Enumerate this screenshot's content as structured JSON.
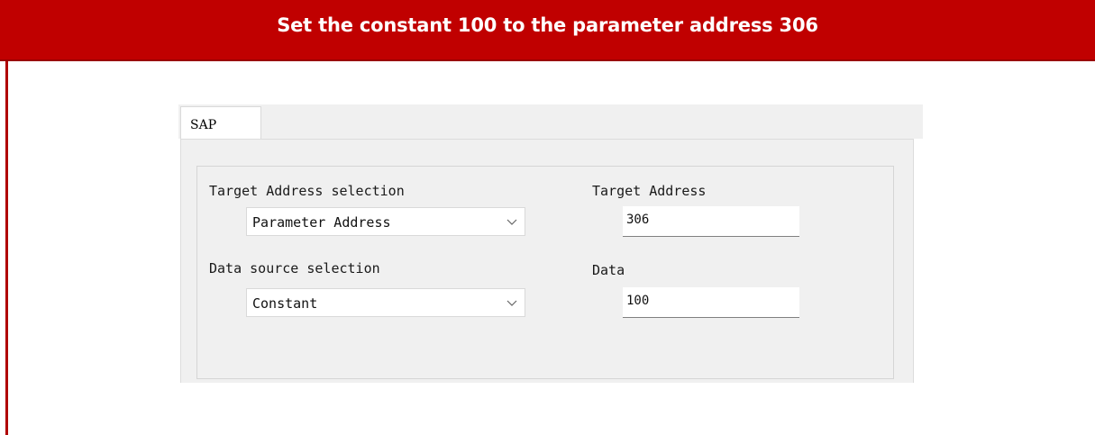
{
  "header": {
    "title": "Set the constant 100 to the parameter address 306"
  },
  "dialog": {
    "tabs": [
      {
        "label": "SAP",
        "selected": true
      }
    ],
    "target_address_selection": {
      "label": "Target Address selection",
      "value": "Parameter Address"
    },
    "target_address": {
      "label": "Target Address",
      "value": "306"
    },
    "data_source_selection": {
      "label": "Data source selection",
      "value": "Constant"
    },
    "data": {
      "label": "Data",
      "value": "100"
    }
  },
  "icons": {
    "dropdown": "chevron-down-icon"
  },
  "colors": {
    "header_bg": "#c00000",
    "header_text": "#ffffff",
    "accent_rule": "#b00000",
    "dialog_bg": "#f0f0f0"
  }
}
